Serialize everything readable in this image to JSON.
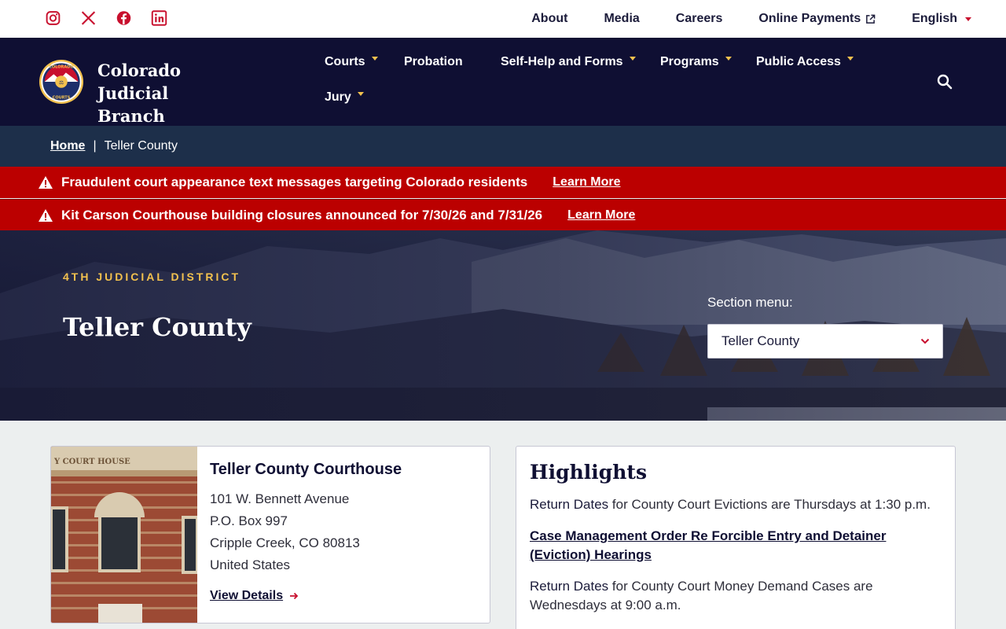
{
  "social": {
    "icons": [
      "instagram-icon",
      "x-icon",
      "facebook-icon",
      "linkedin-icon"
    ],
    "color": "#c8102e"
  },
  "utility_nav": {
    "about": "About",
    "media": "Media",
    "careers": "Careers",
    "online_payments": "Online Payments",
    "language": "English"
  },
  "brand": {
    "name_line1": "Colorado Judicial",
    "name_line2": "Branch",
    "seal_text_top": "COLORADO",
    "seal_text_bottom": "COURTS"
  },
  "main_nav": {
    "courts": "Courts",
    "probation": "Probation",
    "self_help": "Self-Help and Forms",
    "programs": "Programs",
    "public_access": "Public Access",
    "jury": "Jury"
  },
  "breadcrumb": {
    "home": "Home",
    "separator": "|",
    "current": "Teller County"
  },
  "alerts": [
    {
      "message": "Fraudulent court appearance text messages targeting Colorado residents",
      "link": "Learn More"
    },
    {
      "message": "Kit Carson Courthouse building closures announced for 7/30/26 and 7/31/26",
      "link": "Learn More"
    }
  ],
  "hero": {
    "district": "4TH JUDICIAL DISTRICT",
    "title": "Teller County",
    "section_menu_label": "Section menu:",
    "section_menu_selected": "Teller County"
  },
  "courthouse": {
    "title": "Teller County Courthouse",
    "address_line1": "101 W. Bennett Avenue",
    "address_line2": "P.O. Box 997",
    "address_line3": "Cripple Creek, CO 80813",
    "address_line4": "United States",
    "view_details": "View Details"
  },
  "highlights": {
    "title": "Highlights",
    "item1_bold": "Return Dates",
    "item1_rest": " for County Court Evictions are Thursdays at 1:30 p.m.",
    "item2_link": "Case Management Order Re Forcible Entry and Detainer (Eviction) Hearings",
    "item3_bold": "Return Dates",
    "item3_rest": " for County Court Money Demand Cases are Wednesdays at 9:00 a.m."
  },
  "colors": {
    "navy": "#0f0f33",
    "breadcrumb_bg": "#1d2f4a",
    "alert_red": "#bb0000",
    "gold": "#f2c14e"
  }
}
